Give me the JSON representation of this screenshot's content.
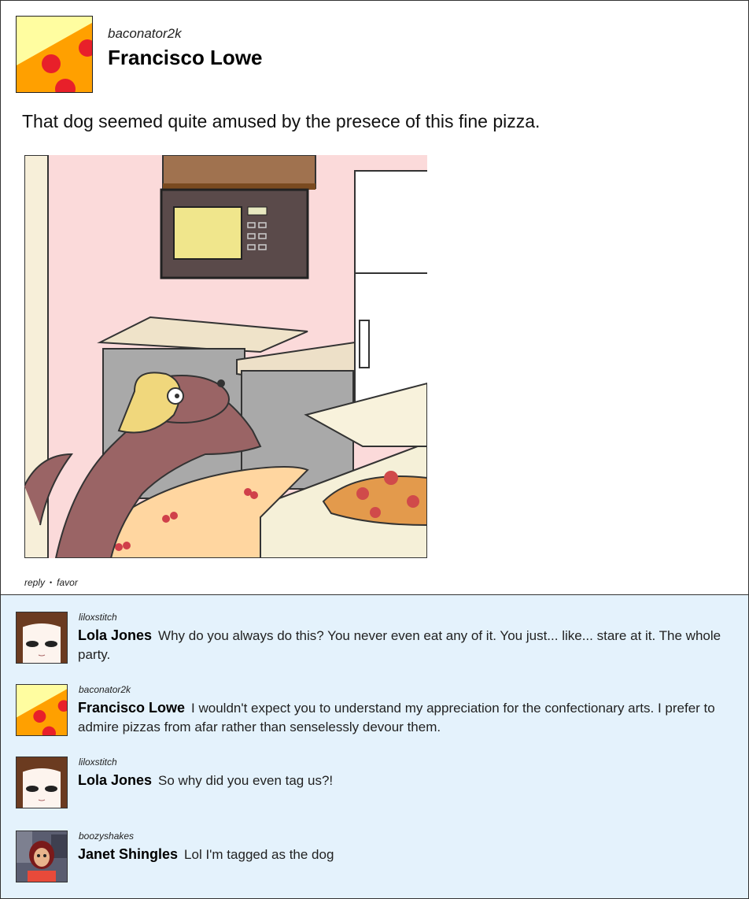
{
  "post": {
    "username": "baconator2k",
    "name": "Francisco Lowe",
    "text": "That dog seemed quite amused by the presece of this fine pizza.",
    "actions": {
      "reply": "reply",
      "separator": "•",
      "favor": "favor"
    }
  },
  "comments": [
    {
      "username": "liloxstitch",
      "name": "Lola Jones",
      "text": "Why do you always do this? You never even eat any of it. You just... like... stare at it. The whole party."
    },
    {
      "username": "baconator2k",
      "name": "Francisco Lowe",
      "text": "I wouldn't expect you to understand my appreciation for the confectionary arts. I prefer to admire pizzas from afar rather than senselessly devour them."
    },
    {
      "username": "liloxstitch",
      "name": "Lola Jones",
      "text": "So why did you even tag us?!"
    },
    {
      "username": "boozyshakes",
      "name": "Janet Shingles",
      "text": "Lol I'm tagged as the dog"
    }
  ],
  "colors": {
    "comments_bg": "#e4f2fc",
    "pizza_cheese": "#ffa000",
    "pizza_pepperoni": "#e8202a"
  }
}
